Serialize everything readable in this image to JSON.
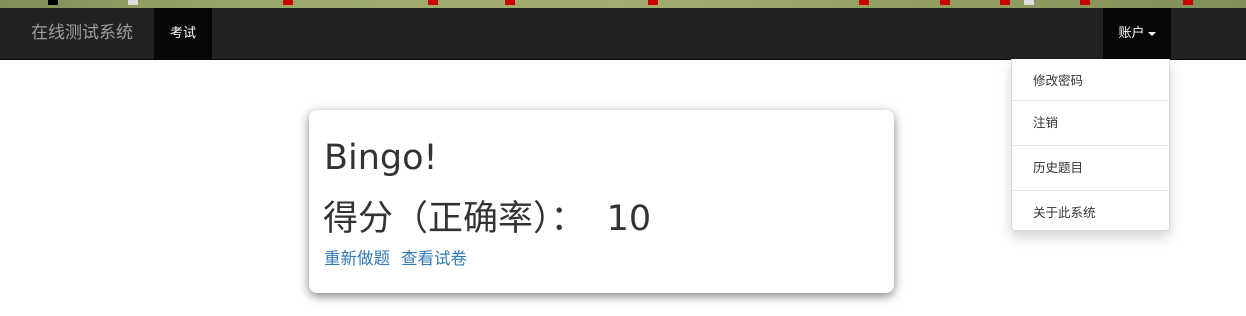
{
  "window": {
    "strip_marks": [
      {
        "color": "#000000"
      },
      {
        "color": "#dddddd"
      },
      {
        "color": "#cc0000"
      },
      {
        "color": "#cc0000"
      },
      {
        "color": "#cc0000"
      },
      {
        "color": "#cc0000"
      },
      {
        "color": "#cc0000"
      },
      {
        "color": "#cc0000"
      },
      {
        "color": "#cc0000"
      },
      {
        "color": "#dddddd"
      },
      {
        "color": "#cc0000"
      },
      {
        "color": "#cc0000"
      }
    ]
  },
  "navbar": {
    "brand": "在线测试系统",
    "tab_exam": "考试",
    "account_label": "账户"
  },
  "account_menu": {
    "items": [
      {
        "label": "修改密码"
      },
      {
        "label": "注销"
      },
      {
        "label": "历史题目"
      },
      {
        "label": "关于此系统"
      }
    ]
  },
  "result": {
    "title": "Bingo!",
    "score_label": "得分（正确率）：",
    "score_value": "10",
    "redo_link": "重新做题",
    "view_link": "查看试卷"
  },
  "colors": {
    "navbar_bg": "#222222",
    "active_bg": "#080808",
    "link": "#337ab7",
    "text": "#333333"
  }
}
